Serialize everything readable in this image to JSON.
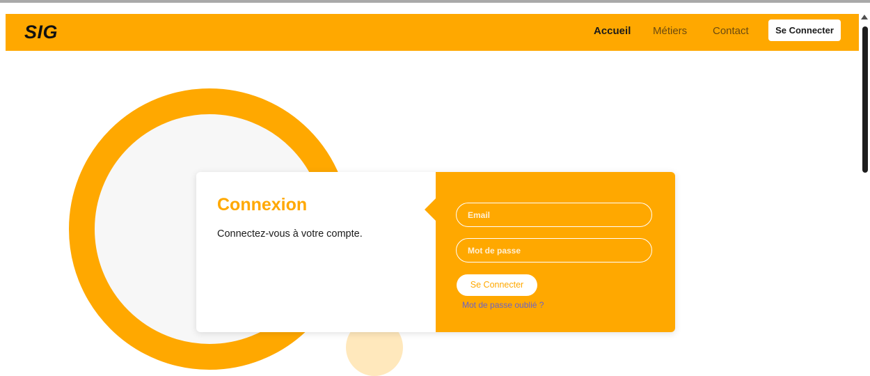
{
  "navbar": {
    "logo": "SIG",
    "links": [
      "Accueil",
      "Métiers",
      "Contact"
    ],
    "login_button": "Se Connecter"
  },
  "login_card": {
    "title": "Connexion",
    "subtitle": "Connectez-vous à votre compte.",
    "email_placeholder": "Email",
    "password_placeholder": "Mot de passe",
    "submit_label": "Se Connecter",
    "forgot_link": "Mot de passe oublié ?"
  },
  "colors": {
    "accent": "#ffa800",
    "ring_inner": "#f7f7f7",
    "link": "#6a63c8"
  }
}
